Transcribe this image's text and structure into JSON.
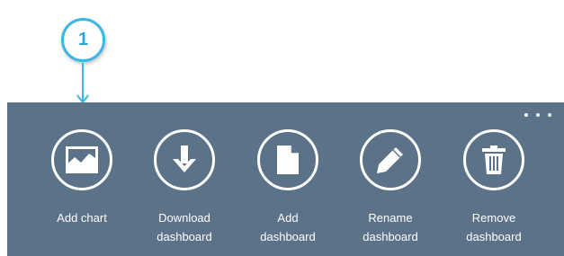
{
  "callout": {
    "number": "1"
  },
  "appbar": {
    "more_label": "",
    "commands": [
      {
        "line1": "Add chart",
        "line2": "",
        "icon": "chart-icon"
      },
      {
        "line1": "Download",
        "line2": "dashboard",
        "icon": "download-icon"
      },
      {
        "line1": "Add",
        "line2": "dashboard",
        "icon": "document-icon"
      },
      {
        "line1": "Rename",
        "line2": "dashboard",
        "icon": "pencil-icon"
      },
      {
        "line1": "Remove",
        "line2": "dashboard",
        "icon": "trash-icon"
      }
    ]
  },
  "colors": {
    "appbar_bg": "#5b7288",
    "callout_accent": "#3db6e3",
    "icon_fg": "#ffffff"
  }
}
